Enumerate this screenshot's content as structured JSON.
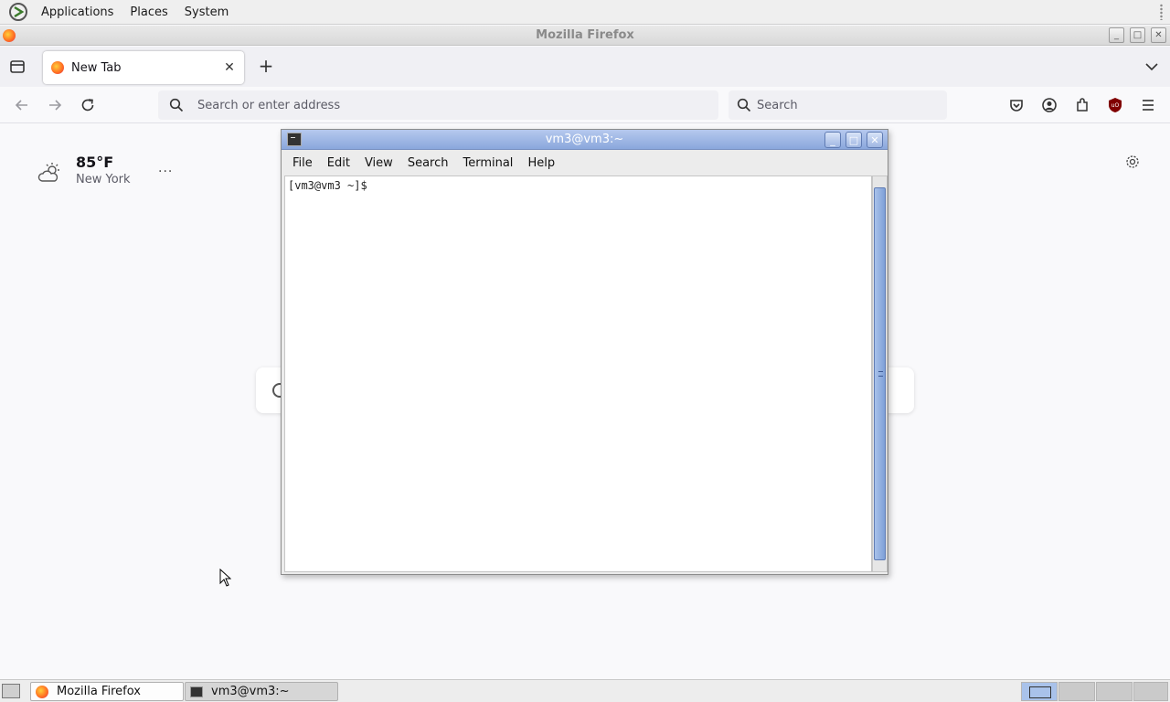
{
  "top_panel": {
    "menus": [
      "Applications",
      "Places",
      "System"
    ],
    "logo_icon": "gnome-foot-icon"
  },
  "firefox": {
    "window_title": "Mozilla Firefox",
    "tab": {
      "label": "New Tab",
      "favicon": "firefox-icon"
    },
    "url_placeholder": "Search or enter address",
    "search_placeholder": "Search",
    "toolbar_icons": [
      "pocket-icon",
      "account-icon",
      "extensions-icon",
      "ublock-icon",
      "menu-icon"
    ]
  },
  "newtab": {
    "weather": {
      "temperature": "85°F",
      "city": "New York",
      "icon": "partly-cloudy-icon"
    },
    "more_label": "···"
  },
  "terminal": {
    "title": "vm3@vm3:~",
    "menus": [
      "File",
      "Edit",
      "View",
      "Search",
      "Terminal",
      "Help"
    ],
    "prompt": "[vm3@vm3 ~]$ "
  },
  "bottom_panel": {
    "tasks": [
      {
        "label": "Mozilla Firefox",
        "icon": "firefox-icon",
        "active": true
      },
      {
        "label": "vm3@vm3:~",
        "icon": "terminal-icon",
        "active": false
      }
    ],
    "workspaces": 4,
    "current_workspace": 1
  },
  "colors": {
    "terminal_titlebar": "#8aa7dc",
    "firefox_accent": "#ff6b22",
    "ublock": "#800000"
  }
}
